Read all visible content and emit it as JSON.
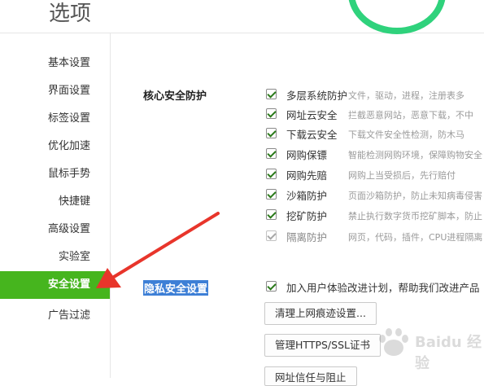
{
  "window": {
    "title": "选项"
  },
  "sidebar": {
    "items": [
      {
        "label": "基本设置",
        "active": false
      },
      {
        "label": "界面设置",
        "active": false
      },
      {
        "label": "标签设置",
        "active": false
      },
      {
        "label": "优化加速",
        "active": false
      },
      {
        "label": "鼠标手势",
        "active": false
      },
      {
        "label": "快捷键",
        "active": false
      },
      {
        "label": "高级设置",
        "active": false
      },
      {
        "label": "实验室",
        "active": false
      },
      {
        "label": "安全设置",
        "active": true
      },
      {
        "label": "广告过滤",
        "active": false
      }
    ]
  },
  "core": {
    "title": "核心安全防护",
    "items": [
      {
        "name": "多层系统防护",
        "desc": "文件，驱动，进程，注册表多",
        "checked": true,
        "enabled": true
      },
      {
        "name": "网址云安全",
        "desc": "拦截恶意网站，恶意下载，不中",
        "checked": true,
        "enabled": true
      },
      {
        "name": "下载云安全",
        "desc": "下载文件安全性检测，防木马",
        "checked": true,
        "enabled": true
      },
      {
        "name": "网购保镖",
        "desc": "智能检测网购环境，保障购物安全",
        "checked": true,
        "enabled": true
      },
      {
        "name": "网购先赔",
        "desc": "网购上当受损后，先行赔付",
        "checked": true,
        "enabled": true
      },
      {
        "name": "沙箱防护",
        "desc": "页面沙箱防护，防止未知病毒侵害",
        "checked": true,
        "enabled": true
      },
      {
        "name": "挖矿防护",
        "desc": "禁止执行数字货币挖矿脚本，防止",
        "checked": true,
        "enabled": true
      },
      {
        "name": "隔离防护",
        "desc": "网页，代码，插件，CPU进程隔离",
        "checked": true,
        "enabled": false
      }
    ]
  },
  "privacy": {
    "title": "隐私安全设置",
    "checkbox_label": "加入用户体验改进计划，帮助我们改进产品",
    "checked": true,
    "buttons": [
      "清理上网痕迹设置...",
      "管理HTTPS/SSL证书",
      "网址信任与阻止"
    ]
  },
  "watermark": {
    "text": "Baidu 经验"
  },
  "colors": {
    "accent": "#46b51e",
    "arrow": "#e8352b",
    "highlight": "#3d7fd6",
    "ring": "#2fd27c"
  }
}
